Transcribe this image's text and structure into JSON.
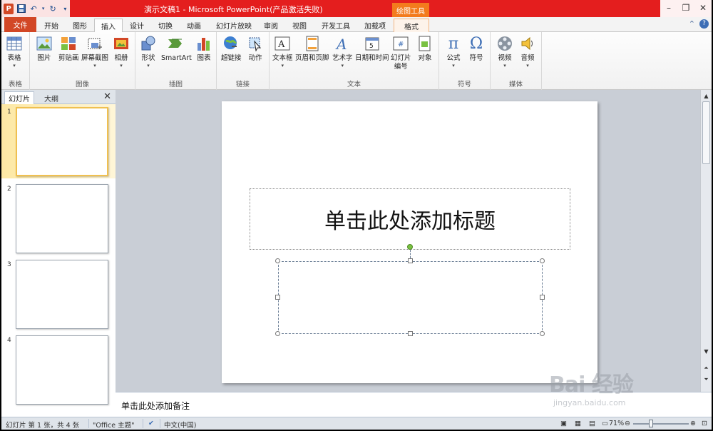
{
  "window": {
    "title": "演示文稿1 - Microsoft PowerPoint(产品激活失败)",
    "context_tab_title": "绘图工具",
    "controls": [
      "minimize-icon",
      "restore-icon",
      "close-icon"
    ]
  },
  "tabs": {
    "file": "文件",
    "items": [
      "开始",
      "图形",
      "插入",
      "设计",
      "切换",
      "动画",
      "幻灯片放映",
      "审阅",
      "视图",
      "开发工具",
      "加载项"
    ],
    "active": "插入",
    "format": "格式"
  },
  "ribbon": {
    "groups": [
      {
        "label": "表格",
        "buttons": [
          {
            "label": "表格",
            "icon": "table-icon",
            "arrow": true
          }
        ]
      },
      {
        "label": "图像",
        "buttons": [
          {
            "label": "图片",
            "icon": "picture-icon",
            "arrow": false
          },
          {
            "label": "剪贴画",
            "icon": "clipart-icon",
            "arrow": false
          },
          {
            "label": "屏幕截图",
            "icon": "screenshot-icon",
            "arrow": true
          },
          {
            "label": "相册",
            "icon": "photo-album-icon",
            "arrow": true
          }
        ]
      },
      {
        "label": "插图",
        "buttons": [
          {
            "label": "形状",
            "icon": "shapes-icon",
            "arrow": true
          },
          {
            "label": "SmartArt",
            "icon": "smartart-icon",
            "arrow": false
          },
          {
            "label": "图表",
            "icon": "chart-icon",
            "arrow": false
          }
        ]
      },
      {
        "label": "链接",
        "buttons": [
          {
            "label": "超链接",
            "icon": "hyperlink-icon",
            "arrow": false
          },
          {
            "label": "动作",
            "icon": "action-icon",
            "arrow": false
          }
        ]
      },
      {
        "label": "文本",
        "buttons": [
          {
            "label": "文本框",
            "icon": "textbox-icon",
            "arrow": true
          },
          {
            "label": "页眉和页脚",
            "icon": "header-footer-icon",
            "arrow": false
          },
          {
            "label": "艺术字",
            "icon": "wordart-icon",
            "arrow": true
          },
          {
            "label": "日期和时间",
            "icon": "date-time-icon",
            "arrow": false
          },
          {
            "label": "幻灯片\n编号",
            "icon": "slide-number-icon",
            "arrow": false
          },
          {
            "label": "对象",
            "icon": "object-icon",
            "arrow": false
          }
        ]
      },
      {
        "label": "符号",
        "buttons": [
          {
            "label": "公式",
            "icon": "equation-icon",
            "arrow": true
          },
          {
            "label": "符号",
            "icon": "symbol-icon",
            "arrow": false
          }
        ]
      },
      {
        "label": "媒体",
        "buttons": [
          {
            "label": "视频",
            "icon": "video-icon",
            "arrow": true
          },
          {
            "label": "音频",
            "icon": "audio-icon",
            "arrow": true
          }
        ]
      }
    ]
  },
  "left_pane": {
    "tab_slides": "幻灯片",
    "tab_outline": "大纲",
    "slide_numbers": [
      "1",
      "2",
      "3",
      "4"
    ]
  },
  "slide": {
    "title_placeholder": "单击此处添加标题"
  },
  "notes": {
    "placeholder": "单击此处添加备注"
  },
  "status": {
    "slide_info": "幻灯片 第 1 张，共 4 张",
    "theme": "\"Office 主题\"",
    "language": "中文(中国)",
    "zoom": "71%"
  },
  "watermark": {
    "main": "Bai 经验",
    "sub": "jingyan.baidu.com"
  },
  "colors": {
    "title_bar": "#e41e1e",
    "file_tab": "#d24726",
    "context_tab": "#f37b1d",
    "selection_handle": "#7ac142"
  }
}
